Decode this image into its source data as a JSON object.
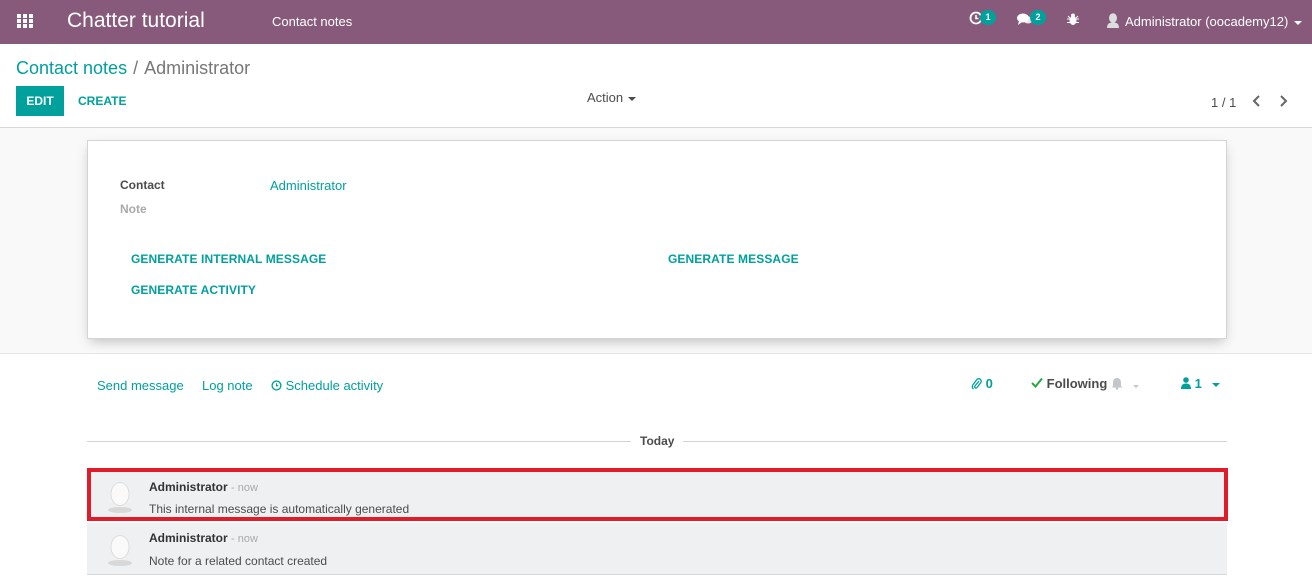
{
  "navbar": {
    "app_title": "Chatter tutorial",
    "menu_item": "Contact notes",
    "activity_badge": "1",
    "messages_badge": "2",
    "user_name": "Administrator (oocademy12)",
    "color": "#875a7b"
  },
  "control_panel": {
    "breadcrumb_parent": "Contact notes",
    "breadcrumb_separator": "/",
    "breadcrumb_current": "Administrator",
    "edit_label": "EDIT",
    "create_label": "CREATE",
    "action_label": "Action",
    "pager": "1 / 1"
  },
  "form": {
    "contact_label": "Contact",
    "contact_value": "Administrator",
    "note_label": "Note",
    "buttons": {
      "generate_internal_message": "GENERATE INTERNAL MESSAGE",
      "generate_message": "GENERATE MESSAGE",
      "generate_activity": "GENERATE ACTIVITY"
    }
  },
  "chatter": {
    "send_message": "Send message",
    "log_note": "Log note",
    "schedule_activity": "Schedule activity",
    "attachments_count": "0",
    "following_label": "Following",
    "followers_count": "1",
    "date_separator": "Today",
    "messages": [
      {
        "author": "Administrator",
        "time": "- now",
        "body": "This internal message is automatically generated"
      },
      {
        "author": "Administrator",
        "time": "- now",
        "body": "Note for a related contact created"
      }
    ]
  },
  "colors": {
    "accent": "#00a09d",
    "highlight_border": "#e11c2a"
  }
}
